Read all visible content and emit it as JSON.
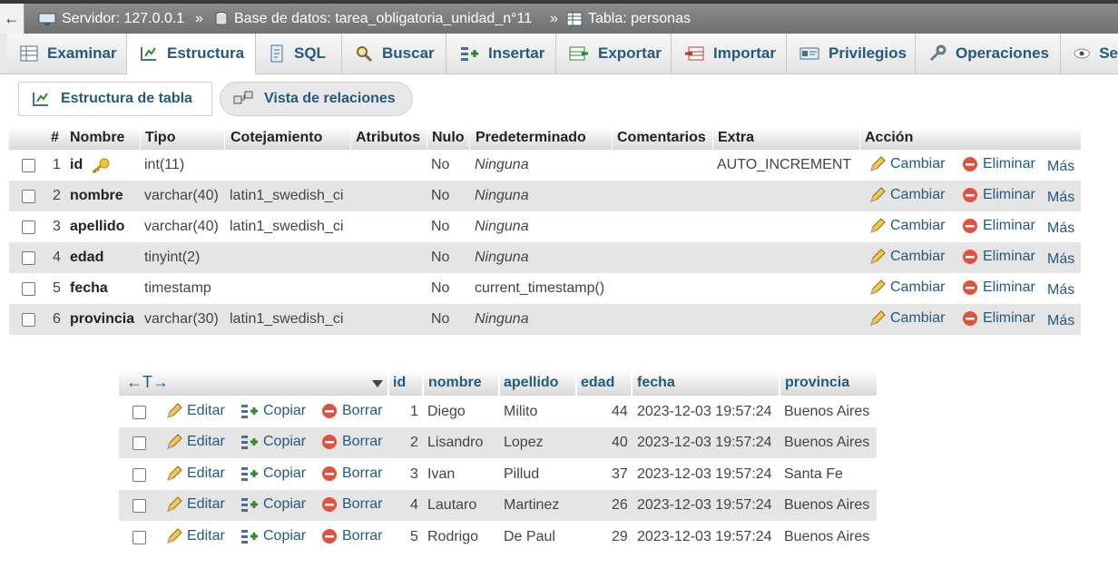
{
  "breadcrumb": {
    "back": "←",
    "server": "Servidor: 127.0.0.1",
    "database": "Base de datos: tarea_obligatoria_unidad_n°11",
    "table": "Tabla: personas",
    "separator": "»"
  },
  "tabs": [
    {
      "label": "Examinar",
      "icon": "browse-icon"
    },
    {
      "label": "Estructura",
      "icon": "structure-icon",
      "active": true
    },
    {
      "label": "SQL",
      "icon": "sql-icon"
    },
    {
      "label": "Buscar",
      "icon": "search-icon"
    },
    {
      "label": "Insertar",
      "icon": "insert-icon"
    },
    {
      "label": "Exportar",
      "icon": "export-icon"
    },
    {
      "label": "Importar",
      "icon": "import-icon"
    },
    {
      "label": "Privilegios",
      "icon": "privileges-icon"
    },
    {
      "label": "Operaciones",
      "icon": "operations-icon"
    },
    {
      "label": "Se",
      "icon": "eye-icon"
    }
  ],
  "subtabs": {
    "structure": "Estructura de tabla",
    "relations": "Vista de relaciones"
  },
  "structure": {
    "headers": {
      "num": "#",
      "name": "Nombre",
      "type": "Tipo",
      "collation": "Cotejamiento",
      "attributes": "Atributos",
      "null": "Nulo",
      "default": "Predeterminado",
      "comments": "Comentarios",
      "extra": "Extra",
      "action": "Acción"
    },
    "actions": {
      "change": "Cambiar",
      "drop": "Eliminar",
      "more": "Más"
    },
    "rows": [
      {
        "num": "1",
        "name": "id",
        "type": "int(11)",
        "collation": "",
        "null": "No",
        "default": "Ninguna",
        "extra": "AUTO_INCREMENT",
        "primary_key": true
      },
      {
        "num": "2",
        "name": "nombre",
        "type": "varchar(40)",
        "collation": "latin1_swedish_ci",
        "null": "No",
        "default": "Ninguna",
        "extra": ""
      },
      {
        "num": "3",
        "name": "apellido",
        "type": "varchar(40)",
        "collation": "latin1_swedish_ci",
        "null": "No",
        "default": "Ninguna",
        "extra": ""
      },
      {
        "num": "4",
        "name": "edad",
        "type": "tinyint(2)",
        "collation": "",
        "null": "No",
        "default": "Ninguna",
        "extra": ""
      },
      {
        "num": "5",
        "name": "fecha",
        "type": "timestamp",
        "collation": "",
        "null": "No",
        "default": "current_timestamp()",
        "extra": ""
      },
      {
        "num": "6",
        "name": "provincia",
        "type": "varchar(30)",
        "collation": "latin1_swedish_ci",
        "null": "No",
        "default": "Ninguna",
        "extra": ""
      }
    ]
  },
  "records": {
    "headers": {
      "arrows": "←T→",
      "id": "id",
      "nombre": "nombre",
      "apellido": "apellido",
      "edad": "edad",
      "fecha": "fecha",
      "provincia": "provincia"
    },
    "actions": {
      "edit": "Editar",
      "copy": "Copiar",
      "delete": "Borrar"
    },
    "rows": [
      {
        "id": "1",
        "nombre": "Diego",
        "apellido": "Milito",
        "edad": "44",
        "fecha": "2023-12-03 19:57:24",
        "provincia": "Buenos Aires"
      },
      {
        "id": "2",
        "nombre": "Lisandro",
        "apellido": "Lopez",
        "edad": "40",
        "fecha": "2023-12-03 19:57:24",
        "provincia": "Buenos Aires"
      },
      {
        "id": "3",
        "nombre": "Ivan",
        "apellido": "Pillud",
        "edad": "37",
        "fecha": "2023-12-03 19:57:24",
        "provincia": "Santa Fe"
      },
      {
        "id": "4",
        "nombre": "Lautaro",
        "apellido": "Martinez",
        "edad": "26",
        "fecha": "2023-12-03 19:57:24",
        "provincia": "Buenos Aires"
      },
      {
        "id": "5",
        "nombre": "Rodrigo",
        "apellido": "De Paul",
        "edad": "29",
        "fecha": "2023-12-03 19:57:24",
        "provincia": "Buenos Aires"
      }
    ]
  },
  "colors": {
    "link": "#235a81",
    "row_alt": "#e5e5e5",
    "breadcrumb_bg": "#7a7a7a",
    "drop_icon": "#e2513d",
    "key_icon": "#e0b020"
  }
}
